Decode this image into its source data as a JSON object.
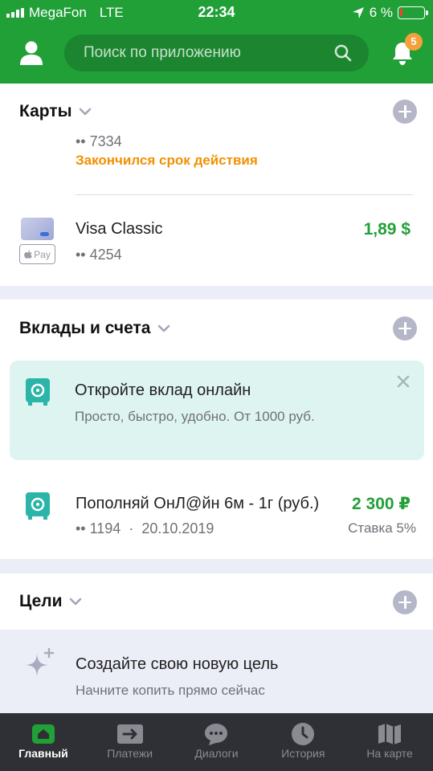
{
  "status_bar": {
    "carrier": "MegaFon",
    "network": "LTE",
    "time": "22:34",
    "battery": "6 %"
  },
  "header": {
    "search_placeholder": "Поиск по приложению",
    "notifications_count": "5"
  },
  "cards_section": {
    "title": "Карты",
    "expired_card": {
      "number": "•• 7334",
      "status": "Закончился срок действия"
    },
    "visa_card": {
      "name": "Visa Classic",
      "number": "•• 4254",
      "balance": "1,89 $",
      "pay_label": "Pay"
    }
  },
  "deposits_section": {
    "title": "Вклады и счета",
    "promo": {
      "title": "Откройте вклад онлайн",
      "subtitle": "Просто, быстро, удобно. От 1000 руб."
    },
    "deposit": {
      "name": "Пополняй ОнЛ@йн 6м - 1г (руб.)",
      "number": "•• 1194",
      "separator": "·",
      "date": "20.10.2019",
      "amount": "2 300 ₽",
      "rate": "Ставка 5%"
    }
  },
  "goals_section": {
    "title": "Цели",
    "create": {
      "title": "Создайте свою новую цель",
      "subtitle": "Начните копить прямо сейчас"
    }
  },
  "tabs": [
    {
      "label": "Главный",
      "icon": "home-icon",
      "active": true
    },
    {
      "label": "Платежи",
      "icon": "payments-icon",
      "active": false
    },
    {
      "label": "Диалоги",
      "icon": "chat-icon",
      "active": false
    },
    {
      "label": "История",
      "icon": "clock-icon",
      "active": false
    },
    {
      "label": "На карте",
      "icon": "map-icon",
      "active": false
    }
  ],
  "colors": {
    "brand": "#21a038",
    "warning": "#f29000",
    "teal": "#2bb5a8",
    "tabbar": "#2f3035"
  }
}
